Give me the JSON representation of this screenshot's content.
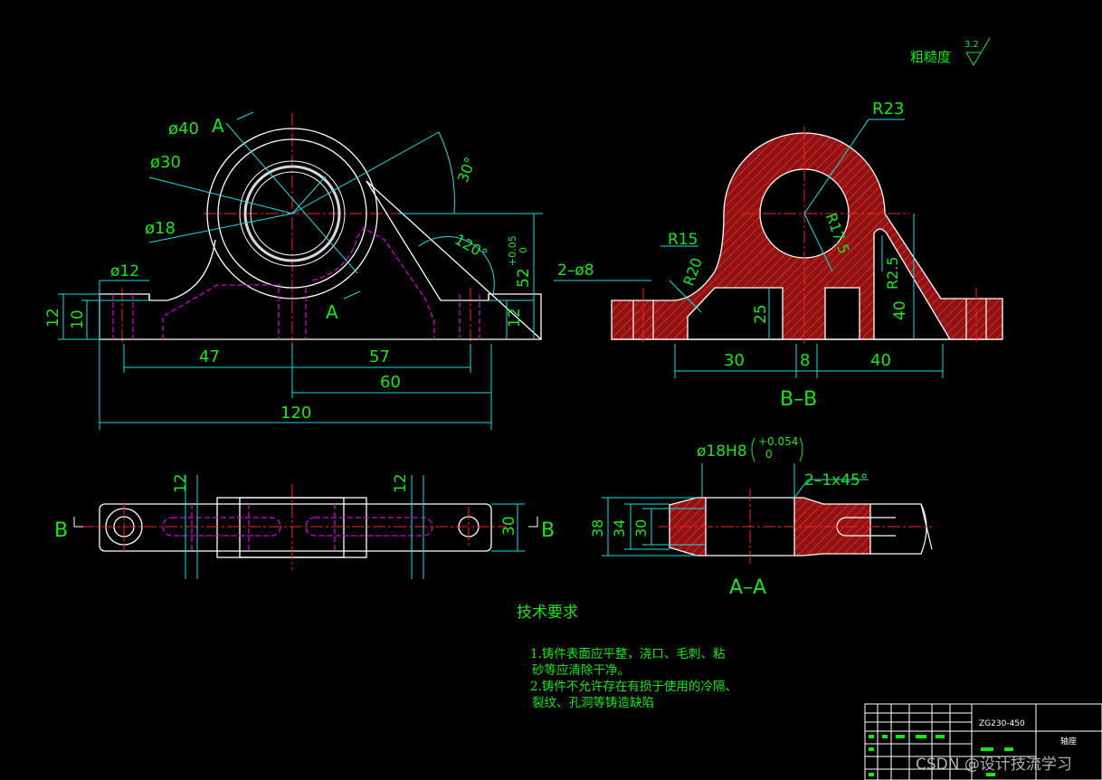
{
  "drawing": {
    "roughness_label": "粗糙度",
    "roughness_value": "3.2",
    "section_bb": "B–B",
    "section_aa": "A–A",
    "view_mark_a": "A",
    "view_mark_b": "B"
  },
  "front_view": {
    "d40": "ø40",
    "d30": "ø30",
    "d18": "ø18",
    "d12": "ø12",
    "angle30": "30°",
    "angle120": "120°",
    "h52": "52",
    "tol_upper": "+0.05",
    "tol_lower": "0",
    "h12_left": "12",
    "h10": "10",
    "h12_right": "12",
    "w47": "47",
    "w57": "57",
    "w60": "60",
    "w120": "120"
  },
  "section_b": {
    "r23": "R23",
    "r15": "R15",
    "r20": "R20",
    "r17_5": "R17.5",
    "r2_5": "R2.5",
    "holes": "2–ø8",
    "h25": "25",
    "h40": "40",
    "w30": "30",
    "w8": "8",
    "w40": "40"
  },
  "top_view": {
    "dim12_left": "12",
    "dim12_right": "12",
    "dim30": "30"
  },
  "section_a": {
    "bore": "ø18H8",
    "bore_tol_upper": "+0.054",
    "bore_tol_lower": "0",
    "chamfer": "2–1x45°",
    "d38": "38",
    "d34": "34",
    "d30": "30"
  },
  "tech": {
    "title": "技术要求",
    "line1": "1.铸件表面应平整，浇口、毛刺、粘",
    "line2": "砂等应清除干净。",
    "line3": "2.铸件不允许存在有损于使用的冷隔、",
    "line4": "裂纹、孔洞等铸造缺陷"
  },
  "title_block": {
    "material": "ZG230-450",
    "part_name": "轴座"
  },
  "watermark": "CSDN @设计技流学习"
}
